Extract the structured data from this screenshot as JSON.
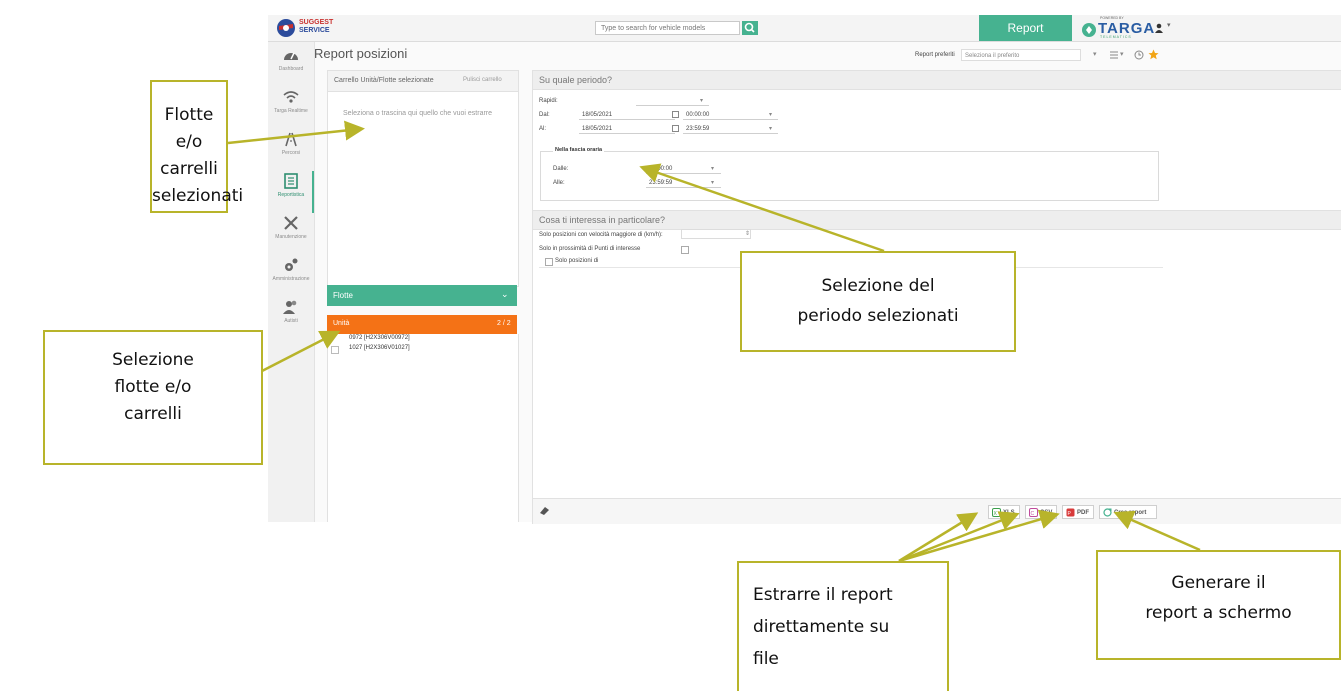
{
  "topbar": {
    "brand_line1": "SUGGEST",
    "brand_line2": "SERVICE",
    "search_placeholder": "Type to search for vehicle models",
    "report_tab": "Report",
    "targa": {
      "powered_by": "POWERED BY",
      "name": "TARGA",
      "sub": "TELEMATICS"
    }
  },
  "sidebar": {
    "items": [
      {
        "label": "Dashboard",
        "icon": "speedometer-icon"
      },
      {
        "label": "Targa Realtime",
        "icon": "wifi-icon"
      },
      {
        "label": "Percorsi",
        "icon": "route-icon"
      },
      {
        "label": "Reportistica",
        "icon": "report-icon"
      },
      {
        "label": "Manutenzione",
        "icon": "tools-icon"
      },
      {
        "label": "Amministrazione",
        "icon": "gears-icon"
      },
      {
        "label": "Autisti",
        "icon": "drivers-icon"
      }
    ]
  },
  "page": {
    "title": "Report posizioni",
    "preferred_label": "Report preferiti",
    "preferred_placeholder": "Seleziona il preferito"
  },
  "cart": {
    "title": "Carrello Unità/Flotte selezionate",
    "empty_button": "Pulisci carrello",
    "hint": "Seleziona o trascina qui quello che vuoi estrarre"
  },
  "fleet": {
    "label": "Flotte"
  },
  "units": {
    "label": "Unità",
    "count": "2 / 2",
    "items": [
      "0972 [H2X306V00972]",
      "1027 [H2X306V01027]"
    ]
  },
  "period": {
    "header": "Su quale periodo?",
    "quick_label": "Rapidi:",
    "from_label": "Dal:",
    "from_date": "18/05/2021",
    "from_time": "00:00:00",
    "to_label": "Al:",
    "to_date": "18/05/2021",
    "to_time": "23:59:59",
    "band_title": "Nella fascia oraria",
    "band_from_label": "Dalle:",
    "band_from_value": "00:00:00",
    "band_to_label": "Alle:",
    "band_to_value": "23:59:59"
  },
  "interest": {
    "header": "Cosa ti interessa in particolare?",
    "speed_label": "Solo posizioni con velocità maggiore di (km/h):",
    "poi_label": "Solo in prossimità di Punti di interesse",
    "only_positions_label": "Solo posizioni di"
  },
  "export": {
    "xls": "XLS",
    "csv": "CSV",
    "pdf": "PDF",
    "create": "Crea report"
  },
  "callouts": {
    "cart": [
      "Flotte e/o",
      "carrelli",
      "selezionati"
    ],
    "selection": [
      "Selezione",
      "flotte e/o",
      "carrelli"
    ],
    "period": [
      "Selezione del",
      "periodo selezionati"
    ],
    "extract": [
      "Estrarre il report",
      "direttamente su",
      "file"
    ],
    "generate": [
      "Generare il",
      "report a schermo"
    ]
  },
  "colors": {
    "accent_green": "#46b290",
    "accent_orange": "#f47216",
    "callout_border": "#b8b42a",
    "targa_blue": "#2a5da3"
  }
}
